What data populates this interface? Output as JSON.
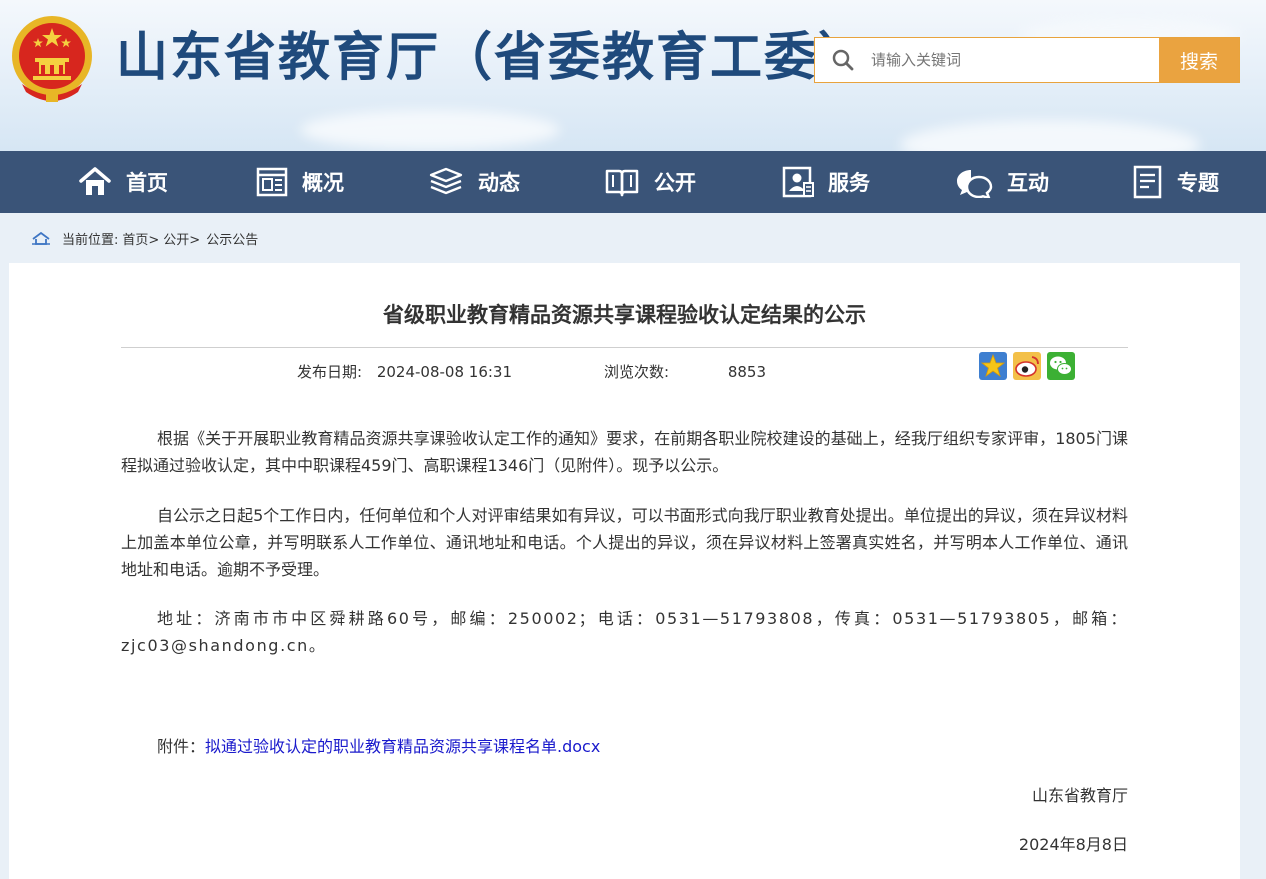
{
  "header": {
    "site_title": "山东省教育厅（省委教育工委）",
    "search_placeholder": "请输入关键词",
    "search_button": "搜索"
  },
  "nav": {
    "items": [
      {
        "label": "首页",
        "icon": "home-icon"
      },
      {
        "label": "概况",
        "icon": "overview-icon"
      },
      {
        "label": "动态",
        "icon": "layers-icon"
      },
      {
        "label": "公开",
        "icon": "book-icon"
      },
      {
        "label": "服务",
        "icon": "service-icon"
      },
      {
        "label": "互动",
        "icon": "chat-icon"
      },
      {
        "label": "专题",
        "icon": "document-icon"
      }
    ]
  },
  "breadcrumb": {
    "prefix": "当前位置:",
    "items": [
      "首页>",
      "公开>",
      "公示公告"
    ]
  },
  "article": {
    "title": "省级职业教育精品资源共享课程验收认定结果的公示",
    "publish_label": "发布日期:",
    "publish_date": "2024-08-08 16:31",
    "views_label": "浏览次数:",
    "views_count": "8853",
    "share_icons": [
      "star-favorite-icon",
      "weibo-icon",
      "wechat-icon"
    ],
    "paragraphs": [
      "根据《关于开展职业教育精品资源共享课验收认定工作的通知》要求，在前期各职业院校建设的基础上，经我厅组织专家评审，1805门课程拟通过验收认定，其中中职课程459门、高职课程1346门（见附件）。现予以公示。",
      "自公示之日起5个工作日内，任何单位和个人对评审结果如有异议，可以书面形式向我厅职业教育处提出。单位提出的异议，须在异议材料上加盖本单位公章，并写明联系人工作单位、通讯地址和电话。个人提出的异议，须在异议材料上签署真实姓名，并写明本人工作单位、通讯地址和电话。逾期不予受理。",
      "地址：济南市市中区舜耕路60号，邮编：250002；电话：0531—51793808，传真：0531—51793805，邮箱：zjc03@shandong.cn。"
    ],
    "attachment_label": "附件：",
    "attachment_link": "拟通过验收认定的职业教育精品资源共享课程名单.docx",
    "signature_org": "山东省教育厅",
    "signature_date": "2024年8月8日"
  },
  "colors": {
    "nav_bg": "#3a5478",
    "title_blue": "#1f4a7c",
    "search_accent": "#eaa340",
    "link_blue": "#1a1acc",
    "emblem_red": "#d7261e",
    "emblem_gold": "#f2c230"
  }
}
